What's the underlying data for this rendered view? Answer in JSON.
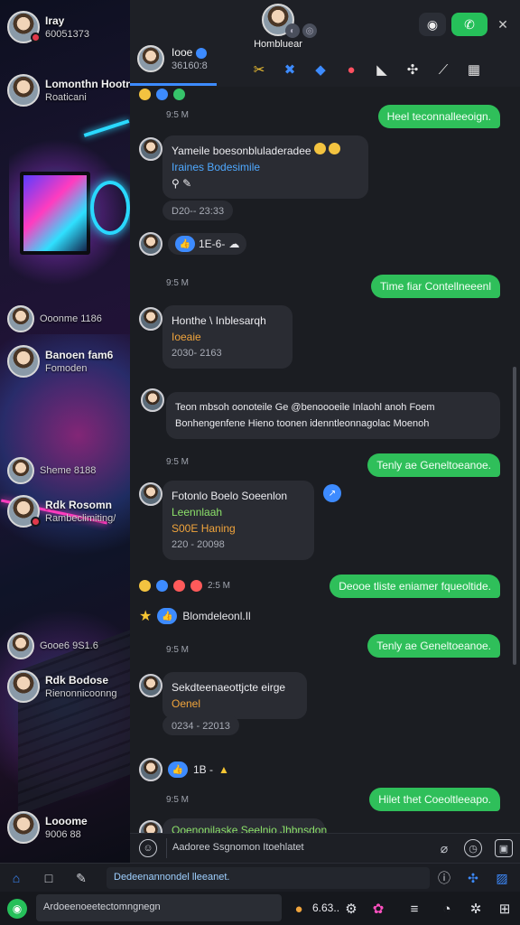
{
  "me": {
    "name": "Iray",
    "status": "60051373"
  },
  "sidebar": {
    "contacts": [
      {
        "name": "Lomonthn Hootnel",
        "sub": "Roaticani"
      },
      {
        "name": "Ooonme 1186",
        "sub": ""
      },
      {
        "name": "Banoen fam6",
        "sub": "Fomoden"
      },
      {
        "name": "Sheme 8188",
        "sub": ""
      },
      {
        "name": "Rdk Rosomn",
        "sub": "Rambeclimiting/"
      },
      {
        "name": "Gooe6 9S1.6",
        "sub": ""
      },
      {
        "name": "Rdk Bodose",
        "sub": "Rienonnicoonng"
      },
      {
        "name": "Looome",
        "sub": "9006 88"
      }
    ]
  },
  "header": {
    "group_name": "Hombluear",
    "chat_title": "Iooe",
    "chat_members": "36160:8"
  },
  "messages": {
    "ts1": "9:5 M",
    "out1": "Heel teconnalleeoign.",
    "in1": {
      "line1": "Yameile boesonbluladeradee",
      "line2": "Iraines Bodesimile",
      "time": "D20-- 23:33"
    },
    "react1": "1E-6-",
    "ts2": "9:5 M",
    "out2": "Time fiar Contellneeenl",
    "in2": {
      "line1": "Honthe \\ Inblesarqh",
      "line2": "Ioeaie",
      "time": "2030- 2163"
    },
    "in3": {
      "line1": "Teon mbsoh oonoteile Ge @benoooeile Inlaohl anoh Foem",
      "line2": "Bonhengenfene Hieno toonen idenntleonnagolac Moenoh"
    },
    "ts3": "9:5 M",
    "out3": "Tenly ae Geneltoeanoe.",
    "in4": {
      "line1": "Fotonlo Boelo Soeenlon",
      "line2": "Leennlaah",
      "line3": "S00E Haning",
      "time": "220 - 20098"
    },
    "ts4": "2:5 M",
    "out4": "Deooe tliste eniamer fqueoltide.",
    "react2": "Blomdeleonl.Il",
    "ts5": "9:5 M",
    "out5": "Tenly ae Geneltoeanoe.",
    "in5": {
      "line1": "Sekdteenaeottjcte eirge",
      "line2": "Oenel",
      "time": "0234 - 22013"
    },
    "react3": "1B -",
    "ts6": "9:5 M",
    "out6": "Hilet thet Coeoltleeapo.",
    "in6": {
      "line1": "Ooenonilaske Seelnjo Jhbnsdon"
    }
  },
  "composer": {
    "placeholder": "Aadoree Ssgnomon Itoehlatet"
  },
  "bottom": {
    "search": "Dedeenannondel lleeanet.",
    "input": "Ardoeenoeetectomngnegn",
    "count": "6.63.."
  }
}
